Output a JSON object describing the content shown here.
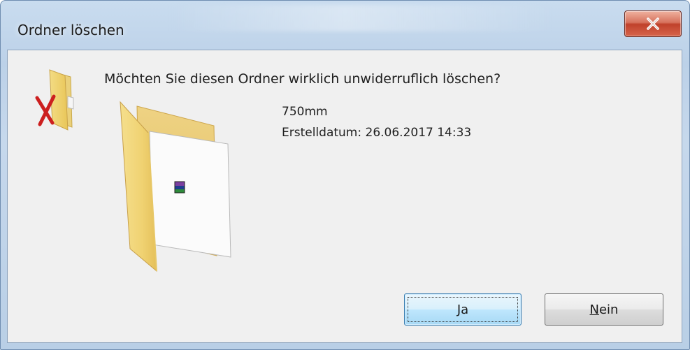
{
  "dialog": {
    "title": "Ordner löschen",
    "close_icon": "close-icon",
    "question": "Möchten Sie diesen Ordner wirklich unwiderruflich löschen?",
    "item_name": "750mm",
    "created_label": "Erstelldatum: 26.06.2017 14:33",
    "icons": {
      "small": "folder-delete-icon",
      "large": "folder-icon",
      "inner": "winrar-archive-icon"
    },
    "buttons": {
      "yes": "Ja",
      "no": "Nein"
    },
    "colors": {
      "title_bar": "#c9dcef",
      "content_bg": "#f0f0f0",
      "close_red": "#c0412b",
      "default_button_border": "#3c7fb1"
    }
  }
}
